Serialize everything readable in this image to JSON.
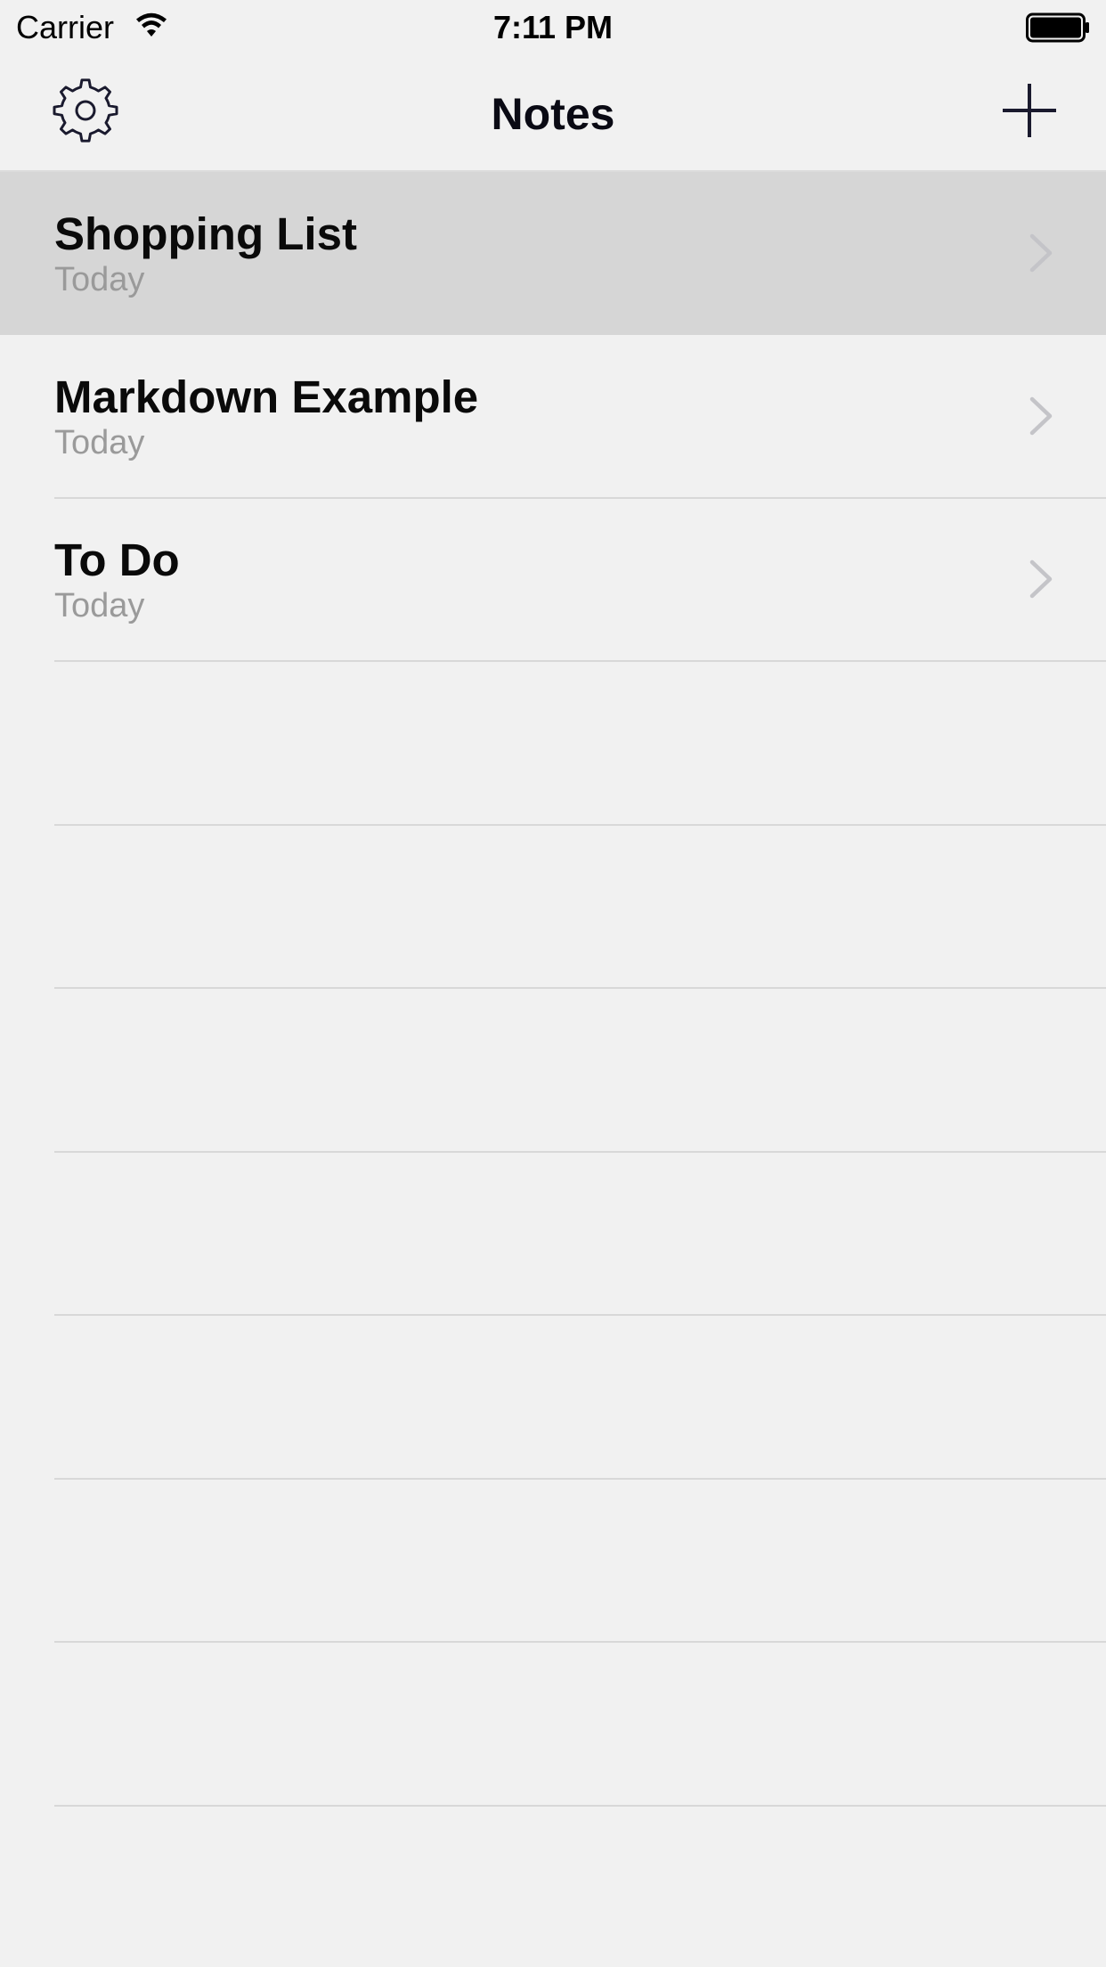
{
  "status_bar": {
    "carrier": "Carrier",
    "time": "7:11 PM"
  },
  "nav": {
    "title": "Notes",
    "left_icon": "gear-icon",
    "right_icon": "plus-icon"
  },
  "notes": [
    {
      "title": "Shopping List",
      "subtitle": "Today",
      "selected": true
    },
    {
      "title": "Markdown Example",
      "subtitle": "Today",
      "selected": false
    },
    {
      "title": "To Do",
      "subtitle": "Today",
      "selected": false
    }
  ],
  "colors": {
    "background": "#f1f1f1",
    "selected_row": "#d6d6d6",
    "subtitle": "#9a9a9a",
    "chevron": "#c4c4c8",
    "separator": "#d8d8d8"
  }
}
